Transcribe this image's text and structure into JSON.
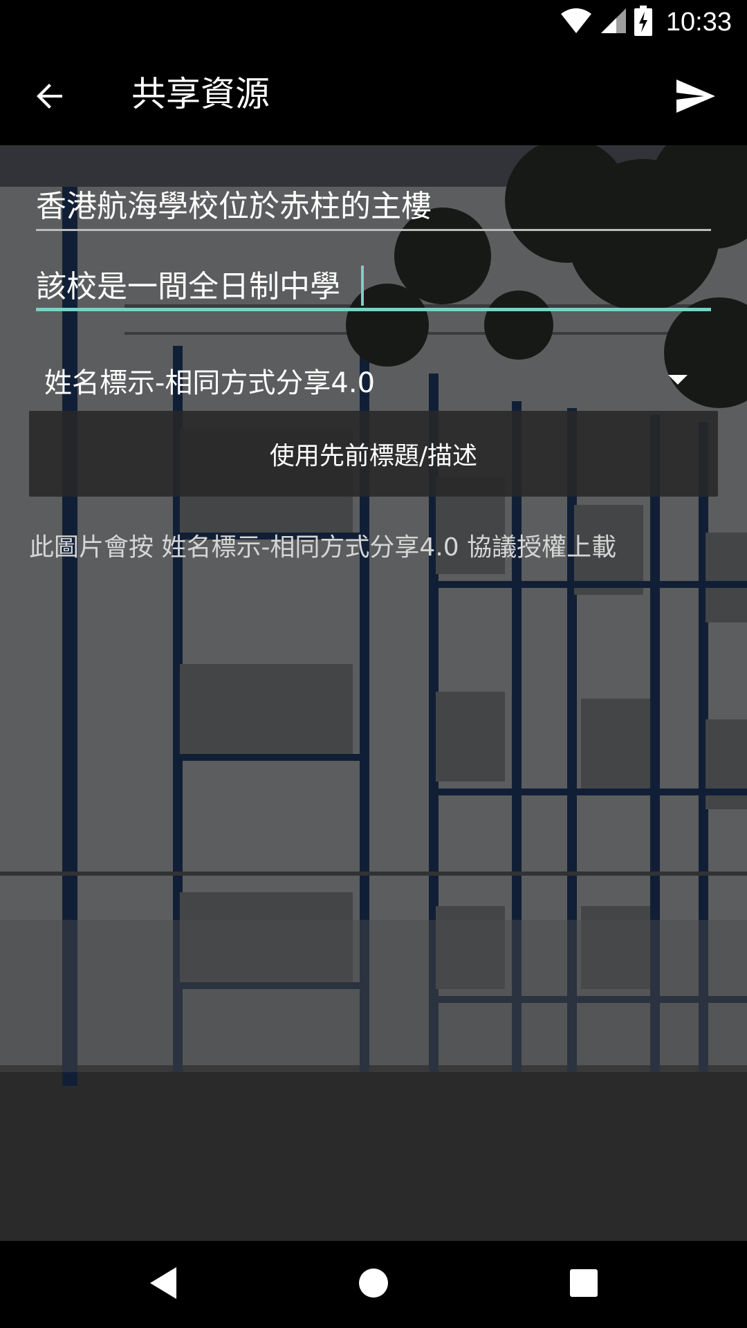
{
  "status_bar": {
    "time": "10:33",
    "icons": [
      "wifi-icon",
      "cell-signal-icon",
      "battery-charging-icon"
    ]
  },
  "toolbar": {
    "title": "共享資源",
    "back_icon": "arrow-back-icon",
    "send_icon": "send-icon"
  },
  "form": {
    "title_value": "香港航海學校位於赤柱的主樓",
    "description_value": "該校是一間全日制中學",
    "license_selected": "姓名標示-相同方式分享4.0",
    "use_previous_label": "使用先前標題/描述",
    "license_note": "此圖片會按 姓名標示-相同方式分享4.0 協議授權上載"
  },
  "nav_bar": {
    "icons": [
      "nav-back-icon",
      "nav-home-icon",
      "nav-recents-icon"
    ]
  },
  "colors": {
    "accent": "#7ecfc6",
    "background": "#000000"
  }
}
